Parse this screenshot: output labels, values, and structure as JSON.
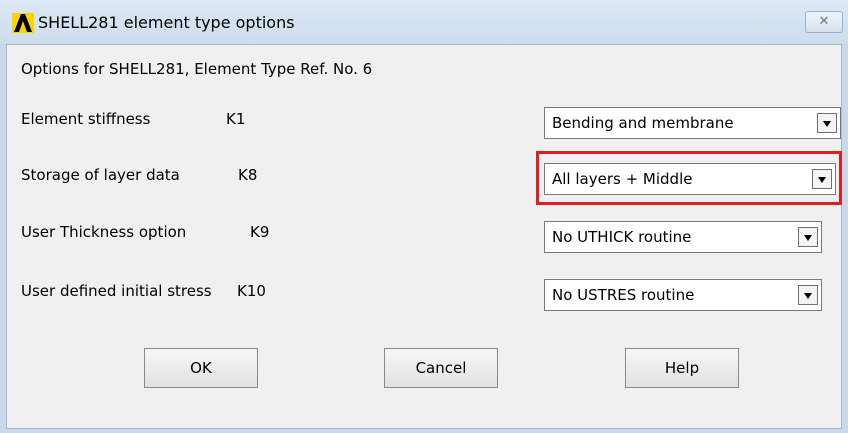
{
  "window": {
    "title": "SHELL281 element type options",
    "close_symbol": "✕",
    "app_icon": "ansys-logo-icon"
  },
  "dialog": {
    "subtitle": "Options for SHELL281, Element Type Ref. No. 6",
    "rows": [
      {
        "label": "Element stiffness",
        "key": "K1",
        "value": "Bending and membrane"
      },
      {
        "label": "Storage of layer data",
        "key": "K8",
        "value": "All layers + Middle"
      },
      {
        "label": "User Thickness option",
        "key": "K9",
        "value": "No UTHICK routine"
      },
      {
        "label": "User defined initial stress",
        "key": "K10",
        "value": "No USTRES routine"
      }
    ],
    "highlight_color": "#e02020"
  },
  "buttons": {
    "ok": "OK",
    "cancel": "Cancel",
    "help": "Help"
  }
}
